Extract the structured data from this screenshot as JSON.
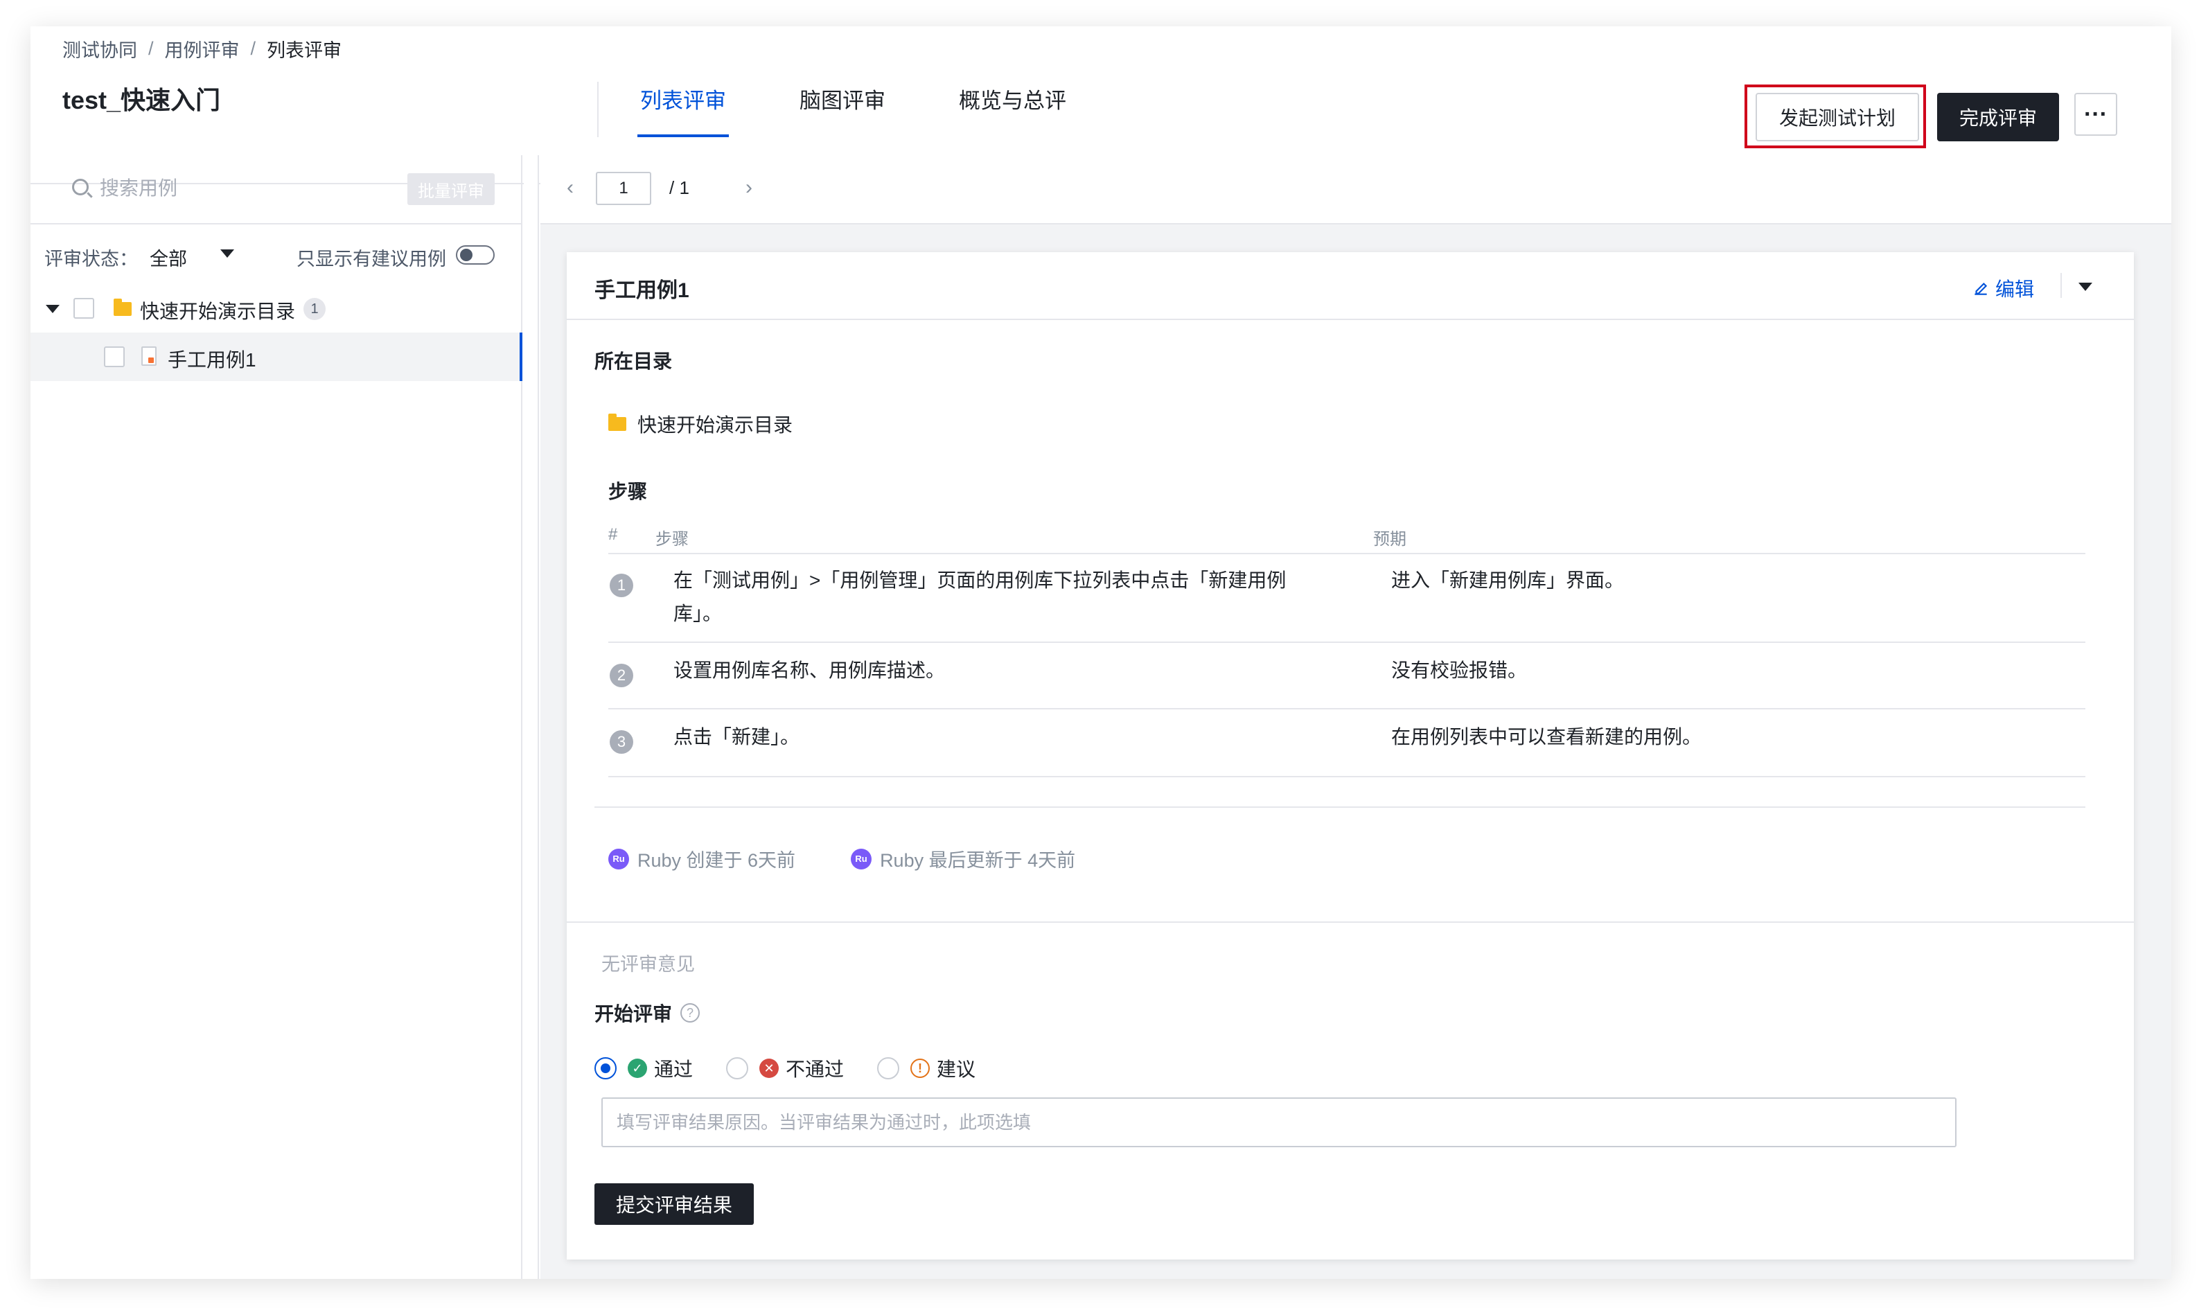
{
  "breadcrumb": [
    "测试协同",
    "用例评审",
    "列表评审"
  ],
  "project": {
    "title": "test_快速入门"
  },
  "tabs": [
    {
      "label": "列表评审",
      "active": true
    },
    {
      "label": "脑图评审",
      "active": false
    },
    {
      "label": "概览与总评",
      "active": false
    }
  ],
  "header": {
    "launch_plan_label": "发起测试计划",
    "finish_review_label": "完成评审",
    "more_label": "···"
  },
  "sidebar": {
    "search_placeholder": "搜索用例",
    "batch_review_label": "批量评审",
    "filter_label": "评审状态：",
    "filter_value": "全部",
    "suggest_only_label": "只显示有建议用例",
    "suggest_only_on": false,
    "tree": {
      "folder_name": "快速开始演示目录",
      "folder_count": "1",
      "case_name": "手工用例1"
    }
  },
  "pager": {
    "current": "1",
    "total": "/ 1",
    "prev": "‹",
    "next": "›"
  },
  "case": {
    "title": "手工用例1",
    "edit_label": "编辑",
    "directory_label": "所在目录",
    "directory_value": "快速开始演示目录",
    "steps_label": "步骤",
    "steps_columns": {
      "num": "#",
      "step": "步骤",
      "expect": "预期"
    },
    "steps": [
      {
        "num": "1",
        "step": "在「测试用例」>「用例管理」页面的用例库下拉列表中点击「新建用例库」。",
        "expect": "进入「新建用例库」界面。"
      },
      {
        "num": "2",
        "step": "设置用例库名称、用例库描述。",
        "expect": "没有校验报错。"
      },
      {
        "num": "3",
        "step": "点击「新建」。",
        "expect": "在用例列表中可以查看新建的用例。"
      }
    ],
    "created": {
      "avatar": "Ru",
      "text": "Ruby 创建于 6天前"
    },
    "updated": {
      "avatar": "Ru",
      "text": "Ruby 最后更新于 4天前"
    }
  },
  "review": {
    "no_comment": "无评审意见",
    "start_label": "开始评审",
    "help_glyph": "?",
    "options": [
      {
        "label": "通过",
        "glyph": "✓",
        "checked": true
      },
      {
        "label": "不通过",
        "glyph": "✕",
        "checked": false
      },
      {
        "label": "建议",
        "glyph": "!",
        "checked": false
      }
    ],
    "reason_placeholder": "填写评审结果原因。当评审结果为通过时，此项选填",
    "submit_label": "提交评审结果"
  },
  "colors": {
    "accent": "#0052d9",
    "dark_button": "#1d2129",
    "highlight_border": "#d0021b",
    "pass": "#2ba471",
    "fail": "#d54941",
    "suggest": "#e37318"
  }
}
